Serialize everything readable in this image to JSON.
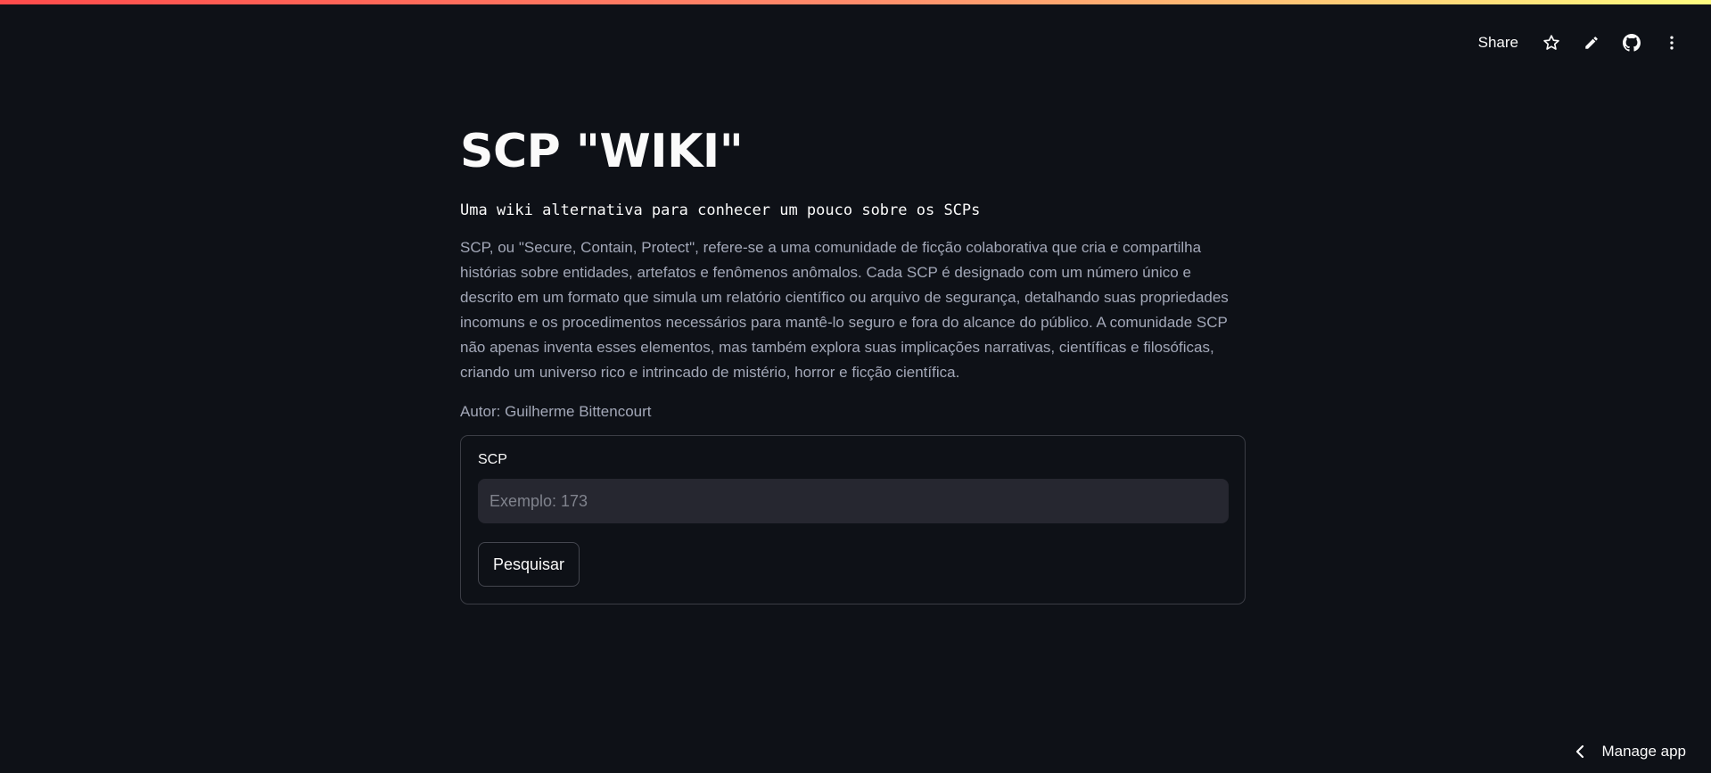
{
  "toolbar": {
    "share_label": "Share",
    "icons": [
      "star-icon",
      "pencil-icon",
      "github-icon",
      "more-vert-icon"
    ]
  },
  "main": {
    "title": "SCP \"WIKI\"",
    "subtitle": "Uma wiki alternativa para conhecer um pouco sobre os SCPs",
    "description": "SCP, ou \"Secure, Contain, Protect\", refere-se a uma comunidade de ficção colaborativa que cria e compartilha histórias sobre entidades, artefatos e fenômenos anômalos. Cada SCP é designado com um número único e descrito em um formato que simula um relatório científico ou arquivo de segurança, detalhando suas propriedades incomuns e os procedimentos necessários para mantê-lo seguro e fora do alcance do público. A comunidade SCP não apenas inventa esses elementos, mas também explora suas implicações narrativas, científicas e filosóficas, criando um universo rico e intrincado de mistério, horror e ficção científica.",
    "author": "Autor: Guilherme Bittencourt"
  },
  "form": {
    "label": "SCP",
    "input_value": "",
    "input_placeholder": "Exemplo: 173",
    "button_label": "Pesquisar"
  },
  "footer": {
    "manage_app_label": "Manage app"
  },
  "colors": {
    "background": "#0e1117",
    "input_background": "#262730",
    "muted_text": "#a3a8b8",
    "accent_gradient": [
      "#ff4b4b",
      "#fffd80"
    ]
  }
}
